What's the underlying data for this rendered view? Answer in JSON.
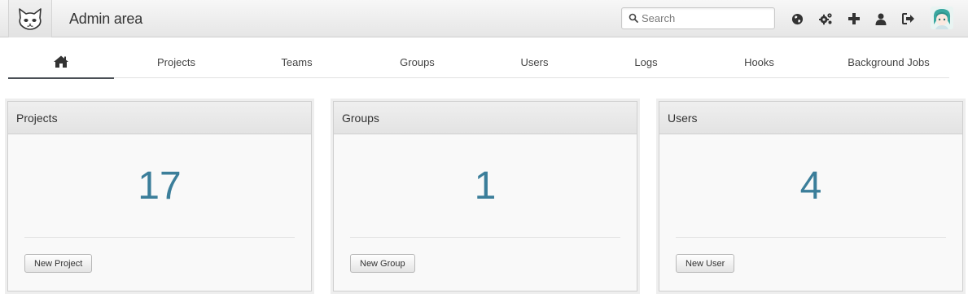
{
  "header": {
    "title": "Admin area",
    "logo_icon": "gitlab-cat-logo-icon",
    "search": {
      "placeholder": "Search",
      "value": ""
    },
    "icons": [
      "globe-icon",
      "gears-icon",
      "plus-icon",
      "user-icon",
      "sign-out-icon"
    ]
  },
  "nav": {
    "tabs": [
      {
        "label": "",
        "icon": "home-icon",
        "active": true
      },
      {
        "label": "Projects"
      },
      {
        "label": "Teams"
      },
      {
        "label": "Groups"
      },
      {
        "label": "Users"
      },
      {
        "label": "Logs"
      },
      {
        "label": "Hooks"
      },
      {
        "label": "Background Jobs"
      }
    ]
  },
  "cards": [
    {
      "title": "Projects",
      "count": "17",
      "button": "New Project"
    },
    {
      "title": "Groups",
      "count": "1",
      "button": "New Group"
    },
    {
      "title": "Users",
      "count": "4",
      "button": "New User"
    }
  ],
  "colors": {
    "accent": "#3b7e9a",
    "icon": "#333333"
  }
}
